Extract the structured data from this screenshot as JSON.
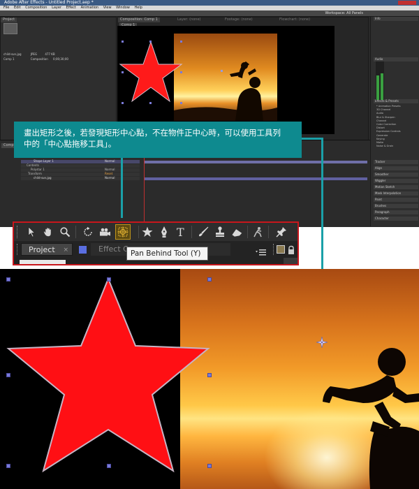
{
  "app": {
    "title": "Adobe After Effects - Untitled Project.aep *",
    "menu": [
      "File",
      "Edit",
      "Composition",
      "Layer",
      "Effect",
      "Animation",
      "View",
      "Window",
      "Help"
    ],
    "workspace": "Workspace",
    "workspace_value": "All Panels"
  },
  "ae_small": {
    "panels": {
      "project": "Project",
      "composition": "Composition: Comp 1",
      "layer": "Layer: (none)",
      "footage": "Footage: (none)",
      "flowchart": "Flowchart: (none)",
      "comp_tab": "Comp 1",
      "timeline_tab": "Comp 1"
    },
    "project_items": [
      {
        "name": "child-sun.jpg",
        "type": "JPEG",
        "size": "477 KB"
      },
      {
        "name": "Comp 1",
        "type": "Composition",
        "duration": "0;00;30;00"
      }
    ],
    "layers": [
      {
        "name": "Shape Layer 1",
        "mode": "Normal"
      },
      {
        "name": "Contents",
        "mode": ""
      },
      {
        "name": "Polystar 1",
        "mode": "Normal"
      },
      {
        "name": "Transform",
        "mode": "Reset"
      },
      {
        "name": "child-sun.jpg",
        "mode": "Normal"
      }
    ],
    "right_panels": [
      "Info",
      "Audio",
      "Effects & Presets",
      "Tracker",
      "Align",
      "Smoother",
      "Wiggler",
      "Motion Sketch",
      "Mask Interpolation",
      "Paint",
      "Brushes",
      "Paragraph",
      "Character"
    ],
    "effect_categories": [
      "* Animation Presets",
      "3D Channel",
      "Audio",
      "Blur & Sharpen",
      "Channel",
      "Color Correction",
      "Distort",
      "Expression Controls",
      "Generate",
      "Keying",
      "Matte",
      "Noise & Grain"
    ],
    "tooltip": "Pan Behind Tool (Y)"
  },
  "callout": {
    "line1": "畫出矩形之後，若發現矩形中心點，不在物件正中心時，可以使用工具列",
    "line2": "中的「中心點拖移工具」。"
  },
  "toolbar_zoom": {
    "tools": [
      {
        "icon": "selection-tool-icon",
        "active": false
      },
      {
        "icon": "hand-tool-icon",
        "active": false
      },
      {
        "icon": "zoom-tool-icon",
        "active": false
      },
      {
        "icon": "rotation-tool-icon",
        "active": false
      },
      {
        "icon": "camera-tool-icon",
        "active": false
      },
      {
        "icon": "pan-behind-tool-icon",
        "active": true
      },
      {
        "icon": "shape-star-tool-icon",
        "active": false
      },
      {
        "icon": "pen-tool-icon",
        "active": false
      },
      {
        "icon": "type-tool-icon",
        "active": false
      },
      {
        "icon": "brush-tool-icon",
        "active": false
      },
      {
        "icon": "clone-stamp-tool-icon",
        "active": false
      },
      {
        "icon": "eraser-tool-icon",
        "active": false
      },
      {
        "icon": "roto-brush-tool-icon",
        "active": false
      },
      {
        "icon": "puppet-pin-tool-icon",
        "active": false
      }
    ],
    "tab_project": "Project",
    "tab_effect": "Effect Co",
    "tooltip": "Pan Behind Tool (Y)",
    "colors": {
      "active_border": "#c0951a",
      "frame": "#c8161c"
    }
  },
  "canvas": {
    "star_fill": "#ff1a1a",
    "star_stroke": "#c9b8c8",
    "handle_color": "#7a7ad8",
    "anchor_icon": "anchor-point-icon"
  }
}
